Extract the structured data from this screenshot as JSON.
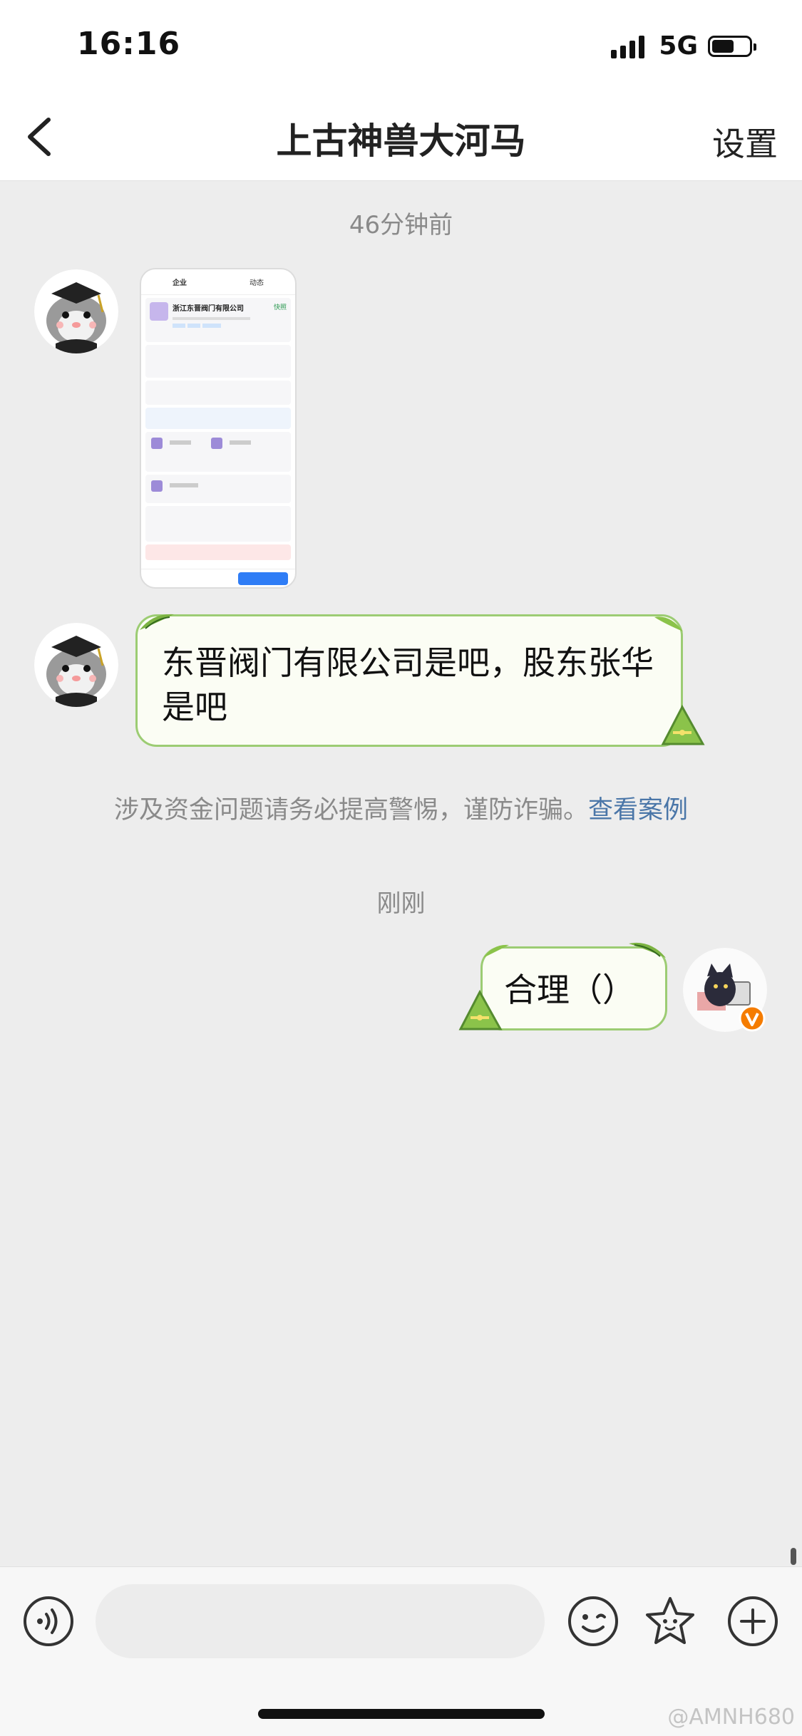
{
  "status_bar": {
    "time": "16:16",
    "network": "5G",
    "battery_level": 0.6
  },
  "nav": {
    "title": "上古神兽大河马",
    "settings_label": "设置"
  },
  "chat": {
    "timestamp_1": "46分钟前",
    "image_message": {
      "tab_labels": [
        "企业",
        "动态"
      ],
      "company_name": "浙江东晋阀门有限公司",
      "badge": "快照"
    },
    "incoming_text": "东晋阀门有限公司是吧，股东张华是吧",
    "warning_text": "涉及资金问题请务必提高警惕，谨防诈骗。",
    "warning_link": "查看案例",
    "timestamp_2": "刚刚",
    "outgoing_text": "合理（）"
  },
  "input_bar": {
    "placeholder": ""
  },
  "watermark": "@AMNH680",
  "colors": {
    "bubble_border": "#9ccc73",
    "bubble_bg": "#fbfdf4",
    "link": "#4a76a8",
    "verified_badge": "#f57c00"
  }
}
